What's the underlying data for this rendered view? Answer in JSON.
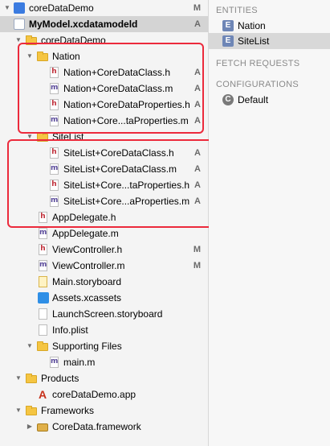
{
  "navigator": {
    "items": [
      {
        "label": "coreDataDemo",
        "icon": "project-icon",
        "status": "M",
        "disclosure": "down"
      },
      {
        "label": "MyModel.xcdatamodeld",
        "icon": "data-model-icon",
        "status": "A",
        "selected": true
      },
      {
        "label": "coreDataDemo",
        "icon": "folder-icon",
        "status": "",
        "disclosure": "down"
      },
      {
        "label": "Nation",
        "icon": "folder-icon",
        "status": "",
        "disclosure": "down"
      },
      {
        "label": "Nation+CoreDataClass.h",
        "icon": "header-file-icon",
        "status": "A"
      },
      {
        "label": "Nation+CoreDataClass.m",
        "icon": "source-file-icon",
        "status": "A"
      },
      {
        "label": "Nation+CoreDataProperties.h",
        "icon": "header-file-icon",
        "status": "A"
      },
      {
        "label": "Nation+Core...taProperties.m",
        "icon": "source-file-icon",
        "status": "A"
      },
      {
        "label": "SiteList",
        "icon": "folder-icon",
        "status": "",
        "disclosure": "down"
      },
      {
        "label": "SiteList+CoreDataClass.h",
        "icon": "header-file-icon",
        "status": "A"
      },
      {
        "label": "SiteList+CoreDataClass.m",
        "icon": "source-file-icon",
        "status": "A"
      },
      {
        "label": "SiteList+Core...taProperties.h",
        "icon": "header-file-icon",
        "status": "A"
      },
      {
        "label": "SiteList+Core...aProperties.m",
        "icon": "source-file-icon",
        "status": "A"
      },
      {
        "label": "AppDelegate.h",
        "icon": "header-file-icon",
        "status": ""
      },
      {
        "label": "AppDelegate.m",
        "icon": "source-file-icon",
        "status": ""
      },
      {
        "label": "ViewController.h",
        "icon": "header-file-icon",
        "status": "M"
      },
      {
        "label": "ViewController.m",
        "icon": "source-file-icon",
        "status": "M"
      },
      {
        "label": "Main.storyboard",
        "icon": "storyboard-icon",
        "status": ""
      },
      {
        "label": "Assets.xcassets",
        "icon": "assets-icon",
        "status": ""
      },
      {
        "label": "LaunchScreen.storyboard",
        "icon": "storyboard-icon",
        "status": ""
      },
      {
        "label": "Info.plist",
        "icon": "plist-file-icon",
        "status": ""
      },
      {
        "label": "Supporting Files",
        "icon": "folder-icon",
        "status": "",
        "disclosure": "down"
      },
      {
        "label": "main.m",
        "icon": "source-file-icon",
        "status": ""
      },
      {
        "label": "Products",
        "icon": "folder-icon",
        "status": "",
        "disclosure": "down"
      },
      {
        "label": "coreDataDemo.app",
        "icon": "app-icon",
        "status": ""
      },
      {
        "label": "Frameworks",
        "icon": "folder-icon",
        "status": "",
        "disclosure": "down"
      },
      {
        "label": "CoreData.framework",
        "icon": "framework-icon",
        "status": "",
        "disclosure": "right"
      }
    ]
  },
  "outline": {
    "entities_header": "ENTITIES",
    "entities": [
      {
        "badge": "E",
        "label": "Nation"
      },
      {
        "badge": "E",
        "label": "SiteList",
        "selected": true
      }
    ],
    "fetch_header": "FETCH REQUESTS",
    "config_header": "CONFIGURATIONS",
    "configurations": [
      {
        "badge": "C",
        "label": "Default"
      }
    ]
  },
  "colors": {
    "highlight_box": "#ec2a3c",
    "selection": "#d4d4d4"
  }
}
